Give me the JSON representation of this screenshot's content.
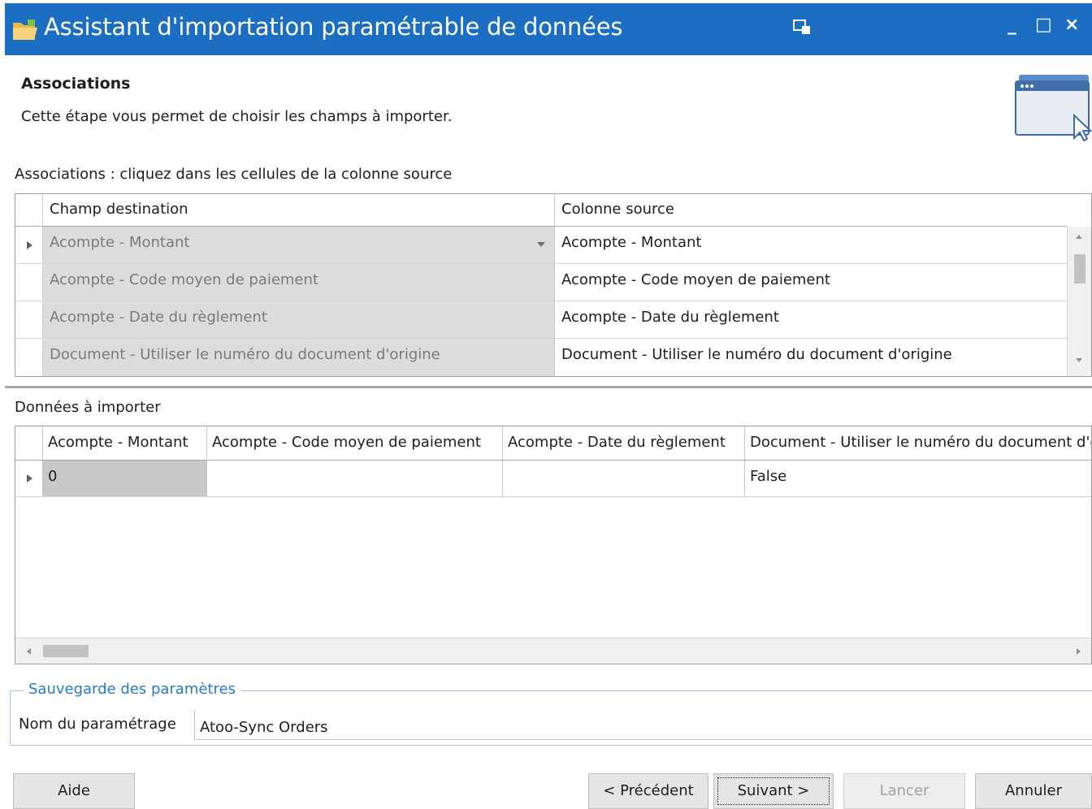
{
  "window": {
    "title": "Assistant d'importation paramétrable de données",
    "controls": {
      "minimize": "_",
      "maximize": "□",
      "close": "×"
    },
    "title_bar_color": "#1b6ec2"
  },
  "header": {
    "title": "Associations",
    "description": "Cette étape vous permet de choisir les champs à importer."
  },
  "associations": {
    "label": "Associations : cliquez dans les cellules de la colonne source",
    "columns": [
      "Champ destination",
      "Colonne source"
    ],
    "rows": [
      {
        "destination": "Acompte - Montant",
        "source": "Acompte - Montant"
      },
      {
        "destination": "Acompte - Code moyen de paiement",
        "source": "Acompte - Code moyen de paiement"
      },
      {
        "destination": "Acompte - Date du règlement",
        "source": "Acompte - Date du règlement"
      },
      {
        "destination": "Document - Utiliser le numéro du document d'origine",
        "source": "Document - Utiliser le numéro du document d'origine"
      }
    ]
  },
  "data_preview": {
    "label": "Données à importer",
    "columns": [
      "Acompte - Montant",
      "Acompte - Code moyen de paiement",
      "Acompte - Date du règlement",
      "Document - Utiliser le numéro du document d'o"
    ],
    "rows": [
      [
        "0",
        "",
        "",
        "False"
      ]
    ]
  },
  "settings": {
    "legend": "Sauvegarde des paramètres",
    "name_label": "Nom du paramétrage",
    "name_value": "Atoo-Sync Orders"
  },
  "buttons": {
    "help": "Aide",
    "previous": "< Précédent",
    "next": "Suivant >",
    "launch": "Lancer",
    "cancel": "Annuler"
  },
  "icons": {
    "title": "folder-icon",
    "titlebar_extra": "monitor-icon",
    "header": "wizard-window-icon"
  }
}
